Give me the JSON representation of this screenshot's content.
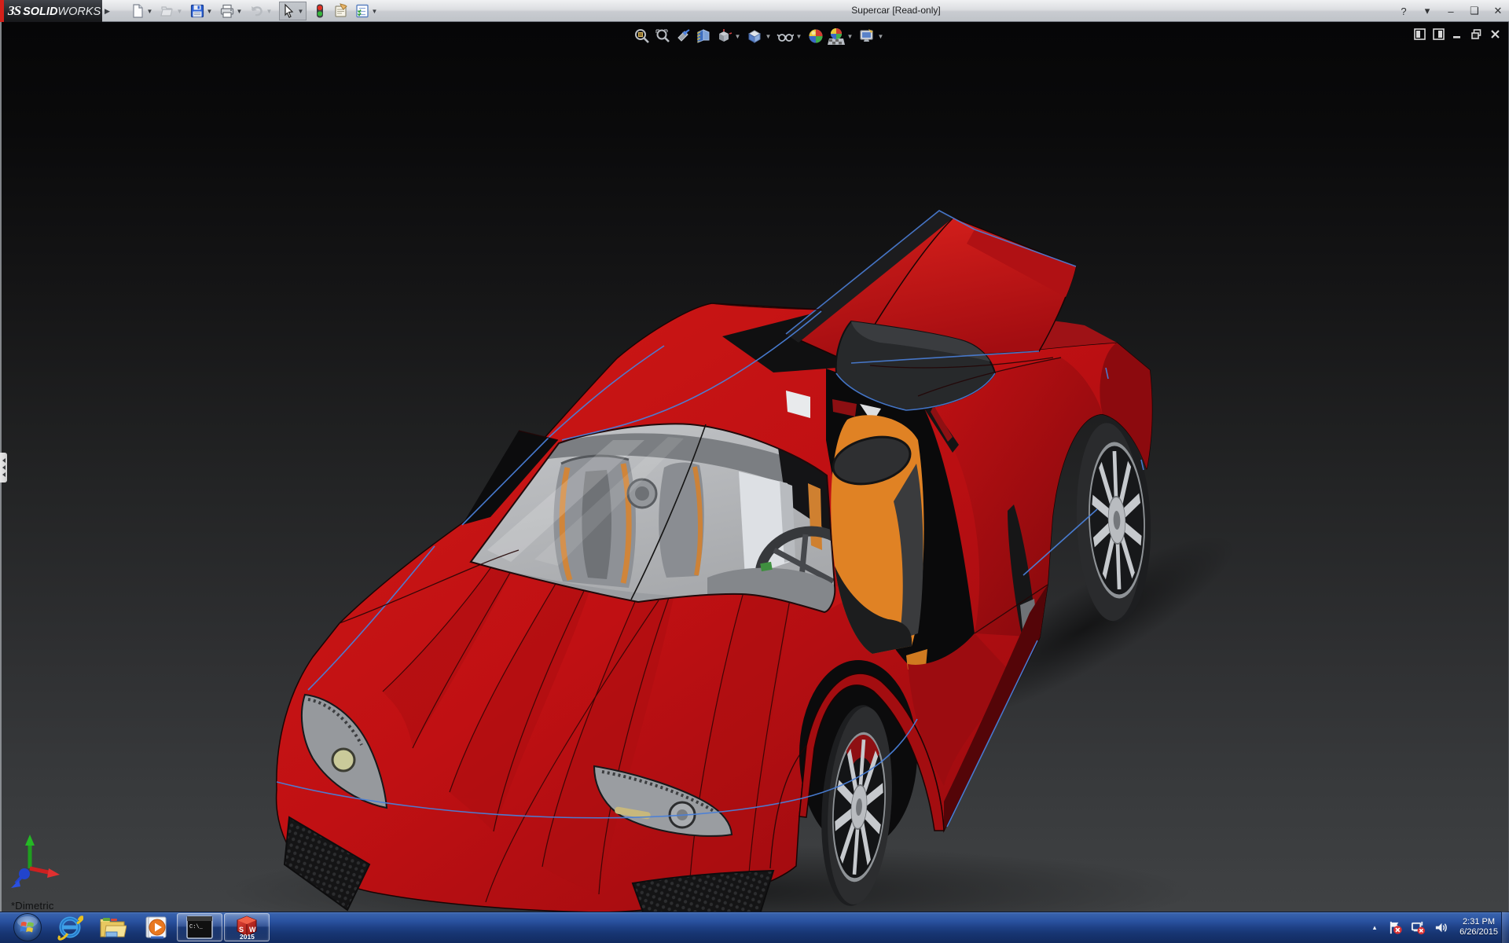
{
  "window": {
    "title": "Supercar [Read-only]",
    "brand": {
      "swirl": "ЗS",
      "solid": "SOLID",
      "works": "WORKS"
    },
    "controls": [
      {
        "name": "help-button",
        "glyph": "?"
      },
      {
        "name": "help-dropdown",
        "glyph": "▾"
      },
      {
        "name": "minimize-button",
        "glyph": "–"
      },
      {
        "name": "restore-button",
        "glyph": "❏"
      },
      {
        "name": "close-button",
        "glyph": "✕"
      }
    ]
  },
  "toolbar": {
    "items": [
      {
        "name": "new-document-icon",
        "dropdown": true,
        "enabled": true
      },
      {
        "name": "open-icon",
        "dropdown": true,
        "enabled": false
      },
      {
        "name": "save-icon",
        "dropdown": true,
        "enabled": true
      },
      {
        "name": "print-icon",
        "dropdown": true,
        "enabled": true
      },
      {
        "name": "undo-icon",
        "dropdown": true,
        "enabled": false
      },
      {
        "name": "select-cursor-icon",
        "dropdown": true,
        "enabled": true,
        "pressed": true
      },
      {
        "name": "rebuild-traffic-light-icon",
        "dropdown": false,
        "enabled": true
      },
      {
        "name": "file-properties-icon",
        "dropdown": false,
        "enabled": true
      },
      {
        "name": "options-checklist-icon",
        "dropdown": true,
        "enabled": true
      }
    ]
  },
  "headsup": {
    "items": [
      {
        "name": "zoom-to-fit-icon",
        "dropdown": false
      },
      {
        "name": "zoom-to-area-icon",
        "dropdown": false
      },
      {
        "name": "previous-view-icon",
        "dropdown": false
      },
      {
        "name": "section-view-icon",
        "dropdown": false
      },
      {
        "name": "view-orientation-icon",
        "dropdown": true
      },
      {
        "name": "display-style-icon",
        "dropdown": true
      },
      {
        "name": "hide-show-items-icon",
        "dropdown": true
      },
      {
        "name": "edit-appearance-icon",
        "dropdown": false
      },
      {
        "name": "apply-scene-icon",
        "dropdown": true
      },
      {
        "name": "view-settings-icon",
        "dropdown": true
      }
    ]
  },
  "document_window": {
    "controls": [
      {
        "name": "show-left-pane-icon"
      },
      {
        "name": "show-right-pane-icon"
      },
      {
        "name": "doc-minimize-icon"
      },
      {
        "name": "doc-restore-icon"
      },
      {
        "name": "doc-close-icon"
      }
    ]
  },
  "viewport": {
    "view_label": "*Dimetric",
    "flyout_tab_arrows": 3
  },
  "taskbar": {
    "items": [
      {
        "name": "start-button",
        "type": "icon"
      },
      {
        "name": "internet-explorer-icon",
        "type": "icon"
      },
      {
        "name": "windows-explorer-icon",
        "type": "icon"
      },
      {
        "name": "media-player-icon",
        "type": "icon"
      },
      {
        "name": "command-prompt-button",
        "type": "button",
        "label": "C:\\_"
      },
      {
        "name": "solidworks-2015-button",
        "type": "button",
        "letters": "SW",
        "year": "2015"
      }
    ],
    "tray": {
      "expander": "▴",
      "time": "2:31 PM",
      "date": "6/26/2015"
    }
  }
}
